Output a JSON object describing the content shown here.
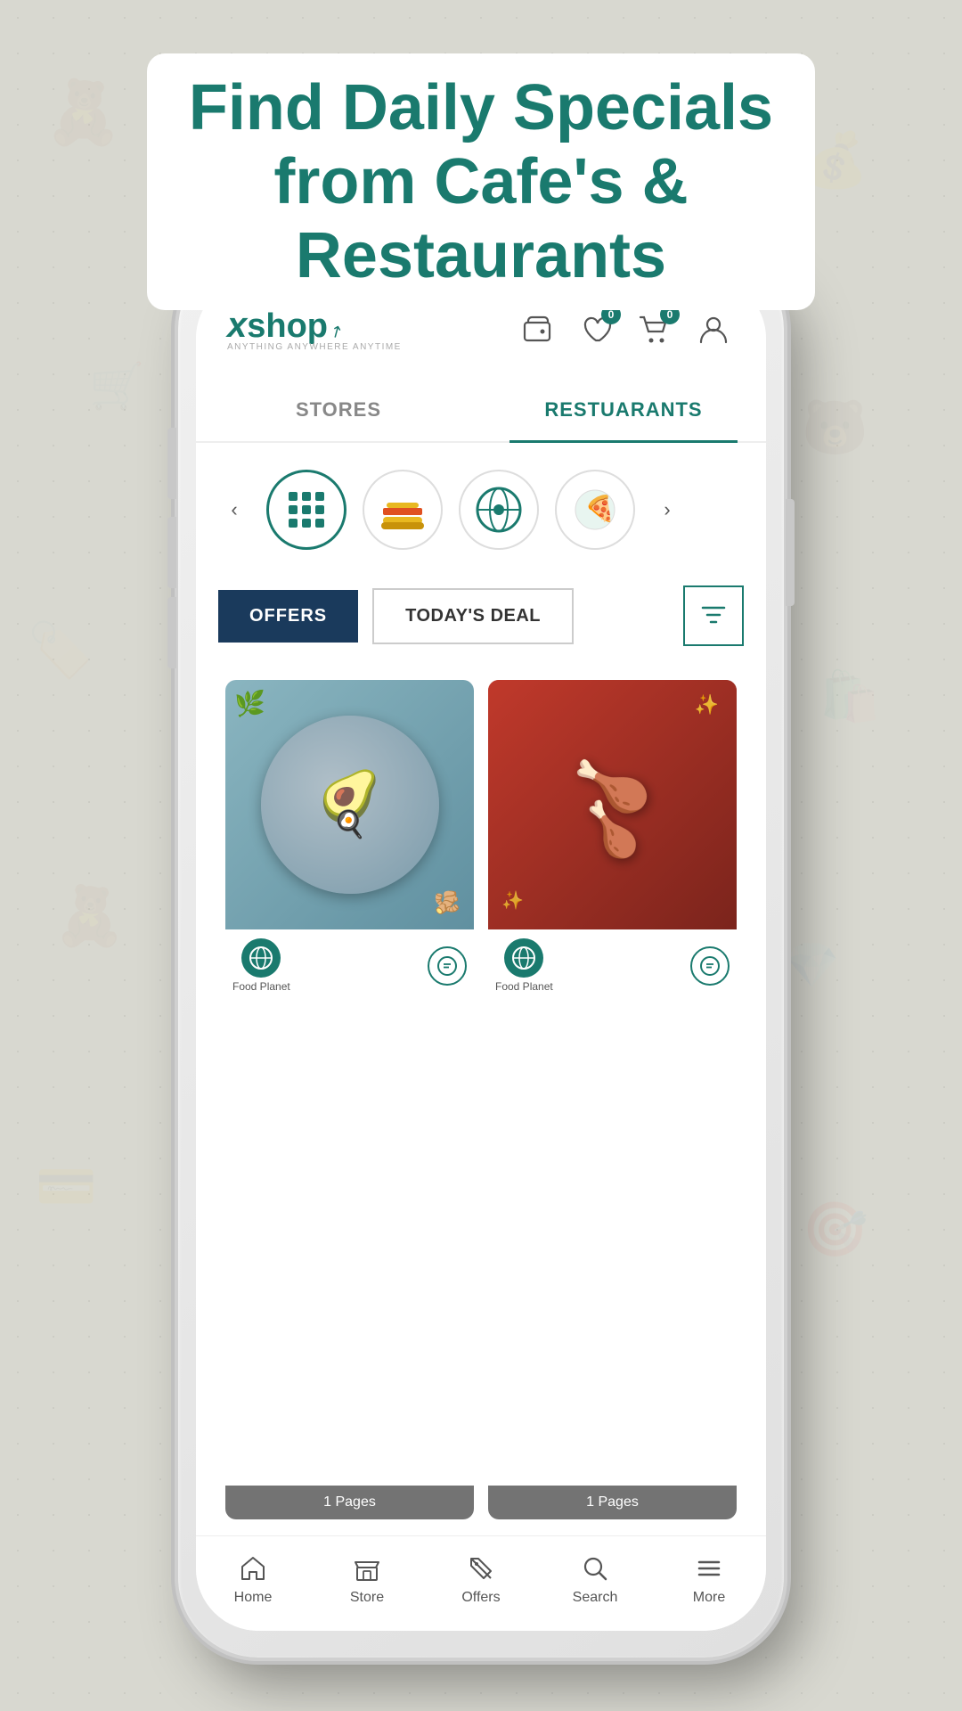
{
  "page": {
    "title": "Find Daily Specials from Cafe's & Restaurants"
  },
  "header": {
    "logo": {
      "brand": "xshop",
      "x_part": "x",
      "shop_part": "shop",
      "tagline": "ANYTHING ANYWHERE ANYTIME"
    },
    "icons": {
      "wallet_label": "wallet",
      "wishlist_label": "wishlist",
      "wishlist_badge": "0",
      "cart_label": "cart",
      "cart_badge": "0",
      "profile_label": "profile"
    }
  },
  "tabs": [
    {
      "id": "stores",
      "label": "STORES",
      "active": false
    },
    {
      "id": "restaurants",
      "label": "RESTUARANTS",
      "active": true
    }
  ],
  "categories": [
    {
      "id": "all",
      "type": "grid",
      "active": true
    },
    {
      "id": "cat1",
      "emoji": "🍔",
      "label": "Fast Food"
    },
    {
      "id": "cat2",
      "emoji": "🪐",
      "label": "Food Planet"
    },
    {
      "id": "cat3",
      "emoji": "🍕",
      "label": "Pizza"
    }
  ],
  "filters": {
    "offers_label": "OFFERS",
    "today_deal_label": "TODAY'S DEAL",
    "filter_label": "Filter"
  },
  "food_cards": [
    {
      "id": "card1",
      "type": "avocado",
      "pages_label": "1 Pages",
      "store_name": "Food Planet",
      "emoji": "🥑"
    },
    {
      "id": "card2",
      "type": "fried_chicken",
      "pages_label": "1 Pages",
      "store_name": "Food Planet",
      "emoji": "🍗"
    }
  ],
  "bottom_nav": [
    {
      "id": "home",
      "label": "Home",
      "icon": "home"
    },
    {
      "id": "store",
      "label": "Store",
      "icon": "store"
    },
    {
      "id": "offers",
      "label": "Offers",
      "icon": "tag"
    },
    {
      "id": "search",
      "label": "Search",
      "icon": "search"
    },
    {
      "id": "more",
      "label": "More",
      "icon": "menu"
    }
  ]
}
